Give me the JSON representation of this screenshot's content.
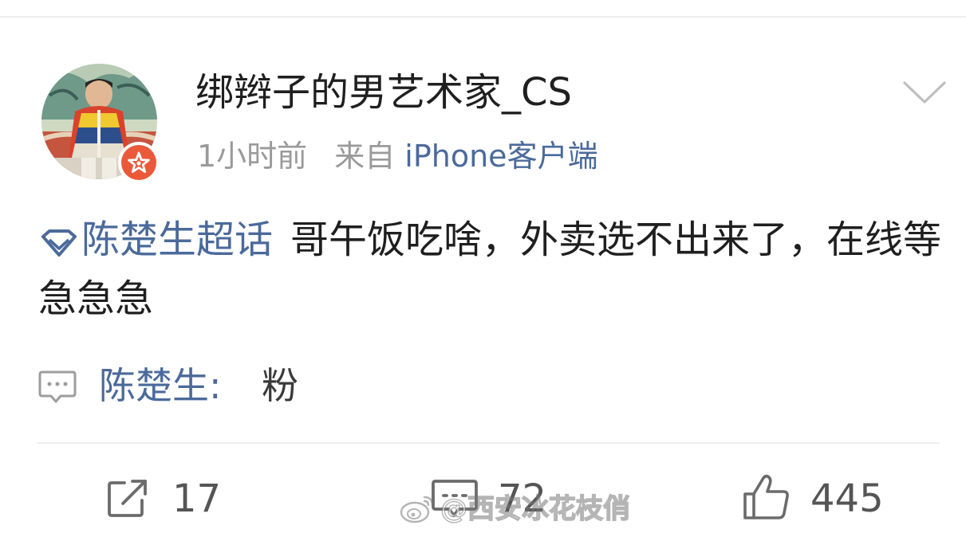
{
  "post": {
    "username": "绑辫子的男艺术家_CS",
    "time": "1小时前",
    "source_prefix": "来自",
    "source_client": "iPhone客户端",
    "topic": "陈楚生超话",
    "text": "哥午饭吃啥，外卖选不出来了，在线等急急急"
  },
  "comment_preview": {
    "author": "陈楚生",
    "separator": ":",
    "text": "粉"
  },
  "actions": {
    "repost_count": "17",
    "comment_count": "72",
    "like_count": "445"
  },
  "watermark": {
    "text": "@西安冰花枝俏"
  },
  "colors": {
    "link_blue": "#4b6a9b",
    "verified_badge": "#ea5a3a",
    "text_primary": "#1f1f1f",
    "text_secondary": "#9a9a9a"
  },
  "icons": {
    "verified": "verified-star-icon",
    "more": "chevron-down-icon",
    "topic": "super-topic-diamond-icon",
    "comment_preview": "comment-bubble-icon",
    "repost": "repost-icon",
    "comment": "comment-icon",
    "like": "thumbs-up-icon",
    "watermark": "weibo-logo-icon"
  }
}
